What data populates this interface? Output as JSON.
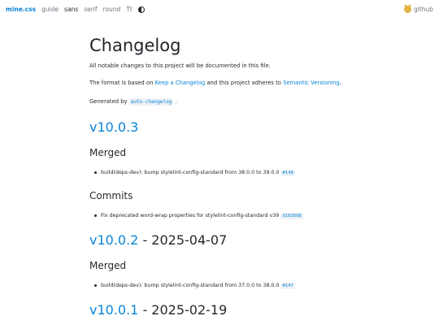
{
  "nav": {
    "brand": "mine.css",
    "links": [
      "guide",
      "sans",
      "serif",
      "round",
      "Tt"
    ],
    "github": "github"
  },
  "page": {
    "title": "Changelog",
    "intro": "All notable changes to this project will be documented in this file.",
    "format_prefix": "The format is based on ",
    "format_link": "Keep a Changelog",
    "format_mid": " and this project adheres to ",
    "format_link2": "Semantic Versioning",
    "format_suffix": ".",
    "generated_prefix": "Generated by ",
    "generated_tool": "auto-changelog",
    "generated_suffix": " ."
  },
  "releases": [
    {
      "version": "v10.0.3",
      "date": "",
      "merged_heading": "Merged",
      "merged_item": "build(deps-dev): bump stylelint-config-standard from 38.0.0 to 39.0.0",
      "merged_ref": "#148",
      "commits_heading": "Commits",
      "commit_item": "Fix deprecated word-wrap properties for stylelint-config-standard v39",
      "commit_ref": "d193898"
    },
    {
      "version": "v10.0.2",
      "date": " - 2025-04-07",
      "merged_heading": "Merged",
      "merged_item": "build(deps-dev): bump stylelint-config-standard from 37.0.0 to 38.0.0",
      "merged_ref": "#147"
    },
    {
      "version": "v10.0.1",
      "date": " - 2025-02-19"
    }
  ]
}
